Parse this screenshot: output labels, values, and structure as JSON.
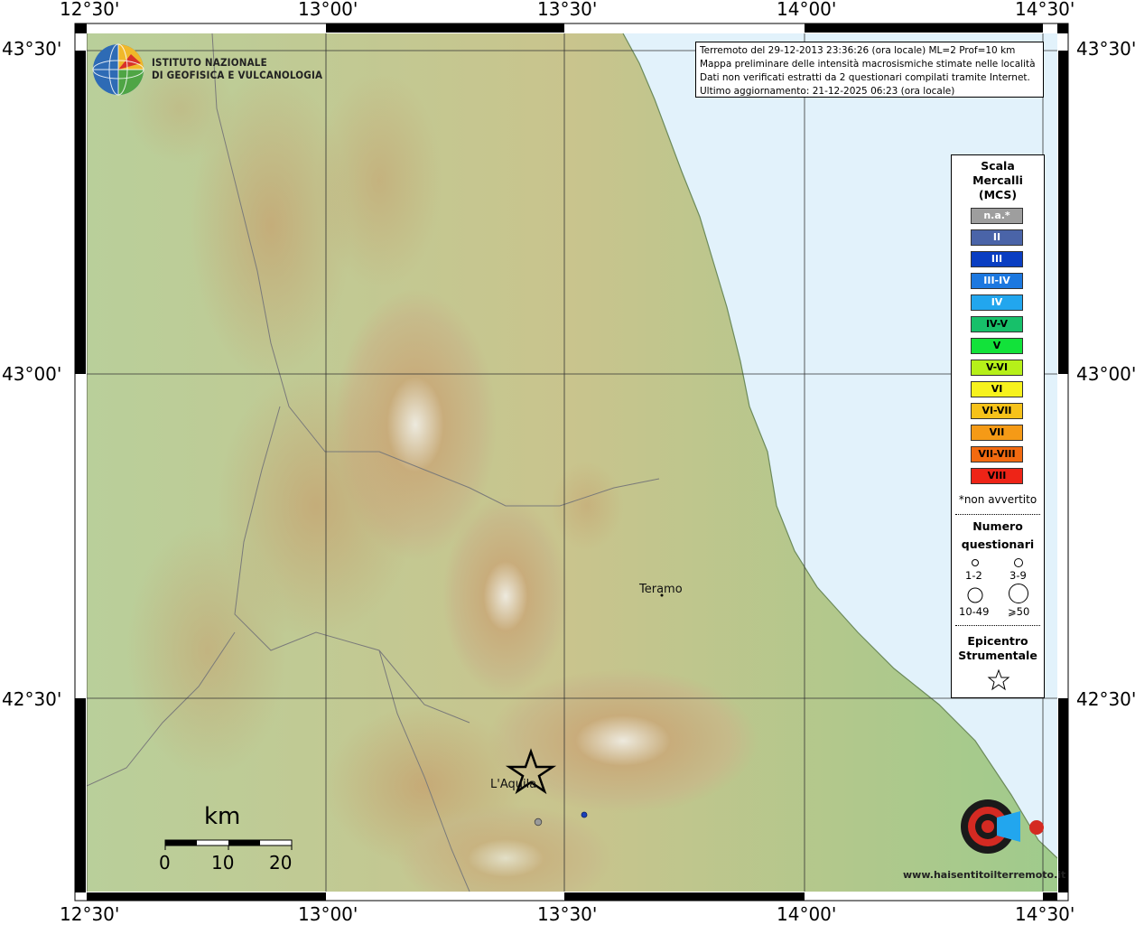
{
  "coordinates": {
    "top": [
      "12°30'",
      "13°00'",
      "13°30'",
      "14°00'",
      "14°30'"
    ],
    "bottom": [
      "12°30'",
      "13°00'",
      "13°30'",
      "14°00'",
      "14°30'"
    ],
    "left": [
      "43°30'",
      "43°00'",
      "42°30'"
    ],
    "right": [
      "43°30'",
      "43°00'",
      "42°30'"
    ]
  },
  "institute": {
    "line1": "ISTITUTO NAZIONALE",
    "line2": "DI GEOFISICA E VULCANOLOGIA"
  },
  "info": {
    "line1": "Terremoto del 29-12-2013 23:36:26 (ora locale) ML=2 Prof=10 km",
    "line2": "Mappa preliminare delle intensità macrosismiche stimate nelle località",
    "line3": "Dati non verificati estratti da 2 questionari compilati tramite Internet.",
    "line4": "Ultimo aggiornamento: 21-12-2025 06:23 (ora locale)"
  },
  "legend": {
    "title1": "Scala",
    "title2": "Mercalli",
    "title3": "(MCS)",
    "levels": [
      {
        "label": "n.a.*",
        "color": "#9e9e9e"
      },
      {
        "label": "II",
        "color": "#4a64a8"
      },
      {
        "label": "III",
        "color": "#0a3ec2"
      },
      {
        "label": "III-IV",
        "color": "#1c78e0"
      },
      {
        "label": "IV",
        "color": "#22a6ee"
      },
      {
        "label": "IV-V",
        "color": "#17c06a"
      },
      {
        "label": "V",
        "color": "#12e23a"
      },
      {
        "label": "V-VI",
        "color": "#b6f019"
      },
      {
        "label": "VI",
        "color": "#f7f21d"
      },
      {
        "label": "VI-VII",
        "color": "#f6c21a"
      },
      {
        "label": "VII",
        "color": "#f59a16"
      },
      {
        "label": "VII-VIII",
        "color": "#f26a10"
      },
      {
        "label": "VIII",
        "color": "#ee2417"
      }
    ],
    "note": "*non avvertito",
    "questionnaires_title1": "Numero",
    "questionnaires_title2": "questionari",
    "q_labels": [
      "1-2",
      "3-9",
      "10-49",
      "⩾50"
    ],
    "epicenter_title1": "Epicentro",
    "epicenter_title2": "Strumentale"
  },
  "cities": {
    "teramo": "Teramo",
    "laquila": "L'Aquila"
  },
  "scale_bar": {
    "unit": "km",
    "ticks": [
      "0",
      "10",
      "20"
    ]
  },
  "survey_points": [
    {
      "name": "gray",
      "color": "#9a9a9a"
    },
    {
      "name": "blue",
      "color": "#1a3fb8"
    }
  ],
  "watermark": {
    "text": "www.haisentitoilterremoto.it"
  }
}
